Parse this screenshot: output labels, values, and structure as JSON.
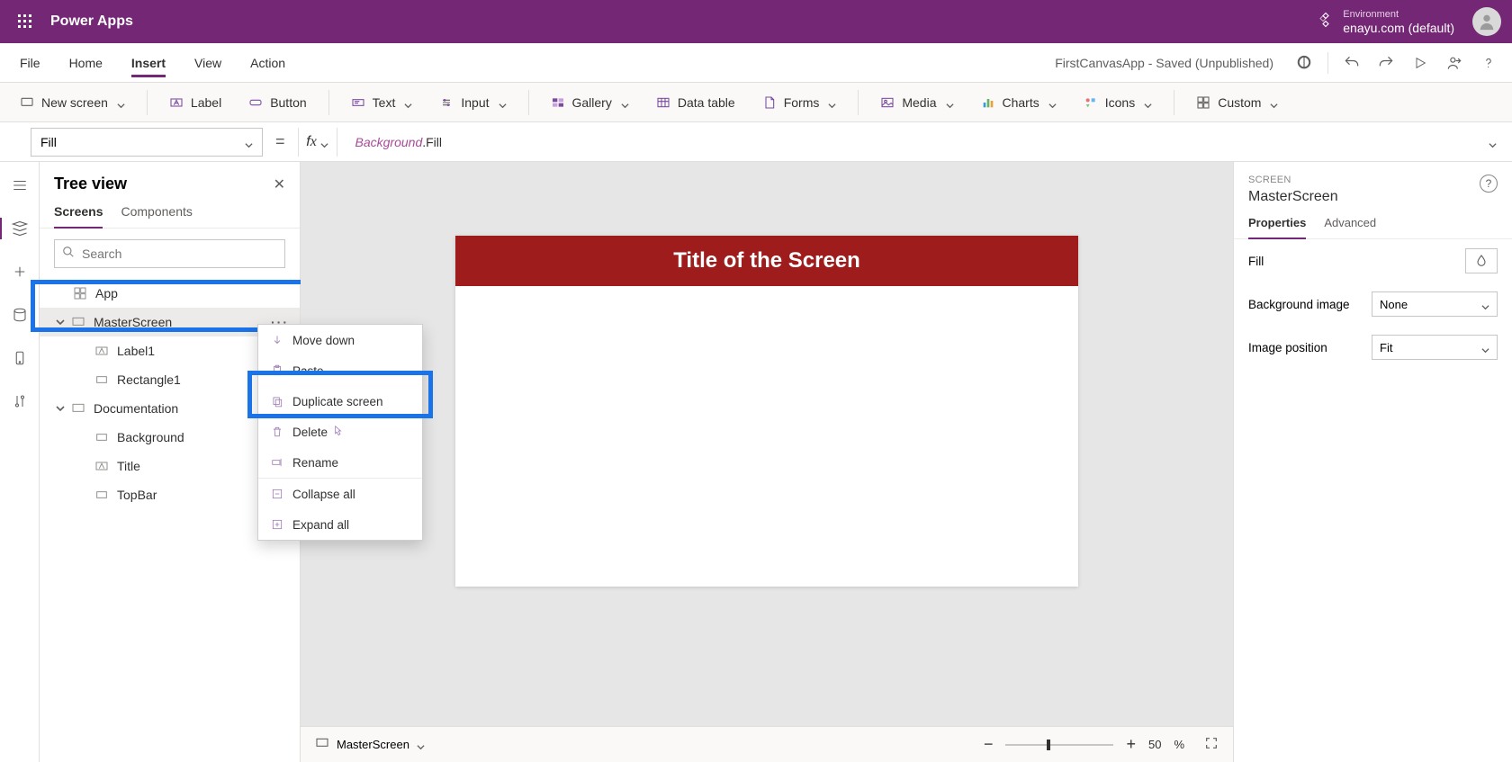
{
  "header": {
    "app_name": "Power Apps",
    "environment_label": "Environment",
    "environment_name": "enayu.com (default)"
  },
  "menu": {
    "items": [
      "File",
      "Home",
      "Insert",
      "View",
      "Action"
    ],
    "active": "Insert",
    "app_status": "FirstCanvasApp - Saved (Unpublished)"
  },
  "ribbon": {
    "new_screen": "New screen",
    "label": "Label",
    "button": "Button",
    "text": "Text",
    "input": "Input",
    "gallery": "Gallery",
    "data_table": "Data table",
    "forms": "Forms",
    "media": "Media",
    "charts": "Charts",
    "icons": "Icons",
    "custom": "Custom"
  },
  "formula": {
    "property": "Fill",
    "expr_var": "Background",
    "expr_mem": ".Fill"
  },
  "tree": {
    "title": "Tree view",
    "tabs": {
      "screens": "Screens",
      "components": "Components"
    },
    "search_placeholder": "Search",
    "items": {
      "app": "App",
      "master": "MasterScreen",
      "label1": "Label1",
      "rectangle1": "Rectangle1",
      "documentation": "Documentation",
      "background": "Background",
      "title": "Title",
      "topbar": "TopBar"
    }
  },
  "context_menu": {
    "move_down": "Move down",
    "paste": "Paste",
    "duplicate_screen": "Duplicate screen",
    "delete": "Delete",
    "rename": "Rename",
    "collapse_all": "Collapse all",
    "expand_all": "Expand all"
  },
  "canvas": {
    "title_text": "Title of the Screen",
    "footer_screen": "MasterScreen",
    "zoom_value": "50",
    "zoom_suffix": "%"
  },
  "props": {
    "type": "SCREEN",
    "name": "MasterScreen",
    "tabs": {
      "properties": "Properties",
      "advanced": "Advanced"
    },
    "fill_label": "Fill",
    "bg_image_label": "Background image",
    "bg_image_value": "None",
    "img_pos_label": "Image position",
    "img_pos_value": "Fit"
  }
}
